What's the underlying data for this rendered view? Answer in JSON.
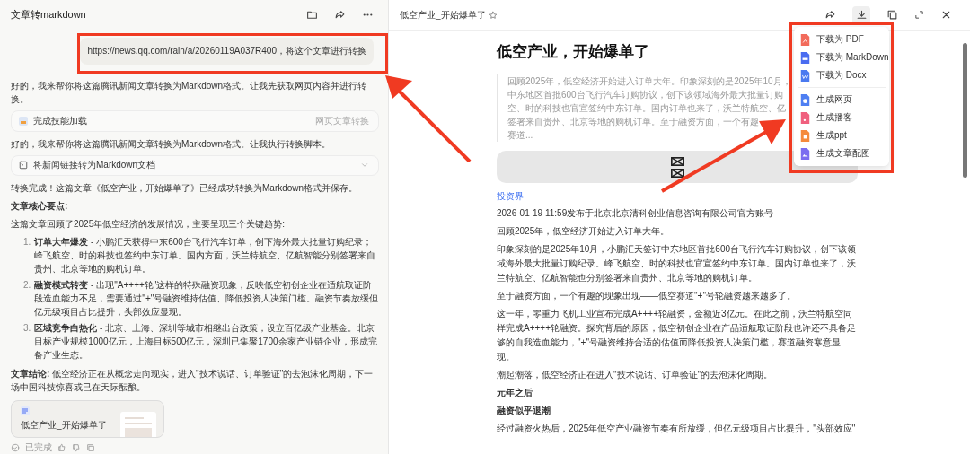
{
  "chat": {
    "title": "文章转markdown",
    "user_message": "https://news.qq.com/rain/a/20260119A037R400，将这个文章进行转换",
    "messages": [
      {
        "kind": "text",
        "text": "好的，我来帮你将这篇腾讯新闻文章转换为Markdown格式。让我先获取网页内容并进行转换。"
      },
      {
        "kind": "tool",
        "label": "完成技能加载",
        "tag": "网页文章转换"
      },
      {
        "kind": "text",
        "text": "好的，我来帮你将这篇腾讯新闻文章转换为Markdown格式。让我执行转换脚本。"
      },
      {
        "kind": "step",
        "label": "将新闻链接转为Markdown文档",
        "expanded": false
      },
      {
        "kind": "text",
        "text": "转换完成！这篇文章《低空产业，开始爆单了》已经成功转换为Markdown格式并保存。"
      },
      {
        "kind": "heading",
        "text": "文章核心要点:"
      },
      {
        "kind": "text",
        "text": "这篇文章回顾了2025年低空经济的发展情况，主要呈现三个关键趋势:"
      }
    ],
    "points": [
      {
        "number": "1.",
        "text": "**订单大年爆发** - 小鹏汇天获得中东600台飞行汽车订单，创下海外最大批量订购纪录；峰飞航空、时的科技也签约中东订单。国内方面，沃兰特航空、亿航智能分别签署来自贵州、北京等地的购机订单。"
      },
      {
        "number": "2.",
        "text": "**融资模式转变** - 出现\"A++++轮\"这样的特殊融资现象，反映低空初创企业在适航取证阶段造血能力不足，需要通过\"+\"号融资维持估值、降低投资人决策门槛。融资节奏放缓但亿元级项目占比提升，头部效应显现。"
      },
      {
        "number": "3.",
        "text": "**区域竞争白热化** - 北京、上海、深圳等城市相继出台政策，设立百亿级产业基金。北京目标产业规模1000亿元，上海目标500亿元，深圳已集聚1700余家产业链企业，形成完备产业生态。"
      }
    ],
    "conclusion": "**文章结论:** 低空经济正在从概念走向现实，进入\"技术说话、订单验证\"的去泡沫化周期，下一场中国科技惊喜或已在天际酝酿。",
    "file_card": {
      "name": "低空产业_开始爆单了"
    },
    "status": "已完成"
  },
  "document": {
    "tab_title": "低空产业_开始爆单了",
    "heading": "低空产业，开始爆单了",
    "summary_lines": [
      "回顾2025年，低空经济开始进入订单大年。印象深刻的是2025年10月，",
      "中东地区首批600台飞行汽车订购协议，创下该领域海外最大批量订购",
      "空、时的科技也官宣签约中东订单。国内订单也来了，沃兰特航空、亿",
      "签署来自贵州、北京等地的购机订单。至于融资方面，一个有趣",
      "赛道..."
    ],
    "source_link": "投资界",
    "paragraphs": [
      {
        "kind": "meta",
        "text": "2026-01-19 11:59发布于北京北京清科创业信息咨询有限公司官方账号"
      },
      {
        "kind": "text",
        "text": "回顾2025年，低空经济开始进入订单大年。"
      },
      {
        "kind": "text",
        "text": "印象深刻的是2025年10月，小鹏汇天签订中东地区首批600台飞行汽车订购协议，创下该领域海外最大批量订购纪录。峰飞航空、时的科技也官宣签约中东订单。国内订单也来了，沃兰特航空、亿航智能也分别签署来自贵州、北京等地的购机订单。"
      },
      {
        "kind": "text",
        "text": "至于融资方面，一个有趣的现象出现——低空赛道\"+\"号轮融资越来越多了。"
      },
      {
        "kind": "text",
        "text": "这一年，零重力飞机工业宣布完成A++++轮融资，金额近3亿元。在此之前，沃兰特航空同样完成A++++轮融资。探究背后的原因，低空初创企业在产品适航取证阶段也许还不具备足够的自我造血能力，\"+\"号融资维持合适的估值而降低投资人决策门槛，赛道融资寒意显现。"
      },
      {
        "kind": "text",
        "text": "潮起潮落，低空经济正在进入\"技术说话、订单验证\"的去泡沫化周期。"
      },
      {
        "kind": "heading",
        "text": "元年之后"
      },
      {
        "kind": "heading",
        "text": "融资似乎退潮"
      },
      {
        "kind": "text",
        "text": "经过融资火热后，2025年低空产业融资节奏有所放缓，但亿元级项目占比提升，\"头部效应\""
      }
    ]
  },
  "export_menu": {
    "open": true,
    "groups": [
      [
        {
          "label": "下载为 PDF",
          "kind": "pdf",
          "color": "#f26b5b"
        },
        {
          "label": "下载为 MarkDown",
          "kind": "md",
          "color": "#4a6cf0"
        },
        {
          "label": "下载为 Docx",
          "kind": "docx",
          "color": "#4a7af0"
        }
      ],
      [
        {
          "label": "生成网页",
          "kind": "web",
          "color": "#4f7ff2"
        },
        {
          "label": "生成播客",
          "kind": "podcast",
          "color": "#f0607e"
        },
        {
          "label": "生成ppt",
          "kind": "ppt",
          "color": "#f58a3c"
        },
        {
          "label": "生成文章配图",
          "kind": "image",
          "color": "#7b6cf0"
        }
      ]
    ]
  }
}
